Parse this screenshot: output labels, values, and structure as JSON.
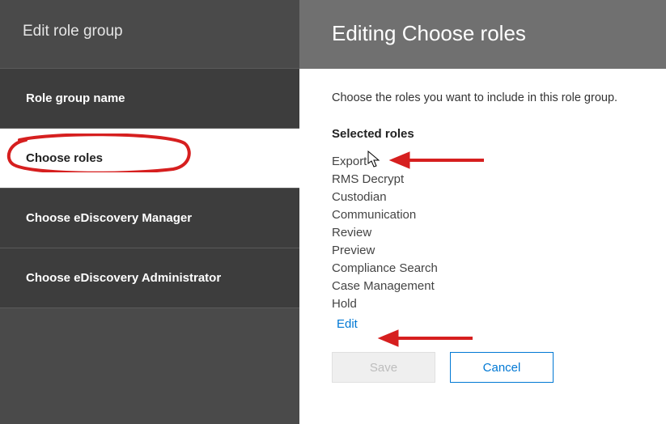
{
  "sidebar": {
    "title": "Edit role group",
    "items": [
      {
        "label": "Role group name"
      },
      {
        "label": "Choose roles"
      },
      {
        "label": "Choose eDiscovery Manager"
      },
      {
        "label": "Choose eDiscovery Administrator"
      }
    ],
    "active_index": 1
  },
  "panel": {
    "title": "Editing Choose roles",
    "intro": "Choose the roles you want to include in this role group.",
    "section_title": "Selected roles",
    "roles": [
      "Export",
      "RMS Decrypt",
      "Custodian",
      "Communication",
      "Review",
      "Preview",
      "Compliance Search",
      "Case Management",
      "Hold"
    ],
    "edit_link": "Edit",
    "buttons": {
      "save": "Save",
      "cancel": "Cancel"
    },
    "save_enabled": false
  },
  "annotation_color": "#d61f1f"
}
